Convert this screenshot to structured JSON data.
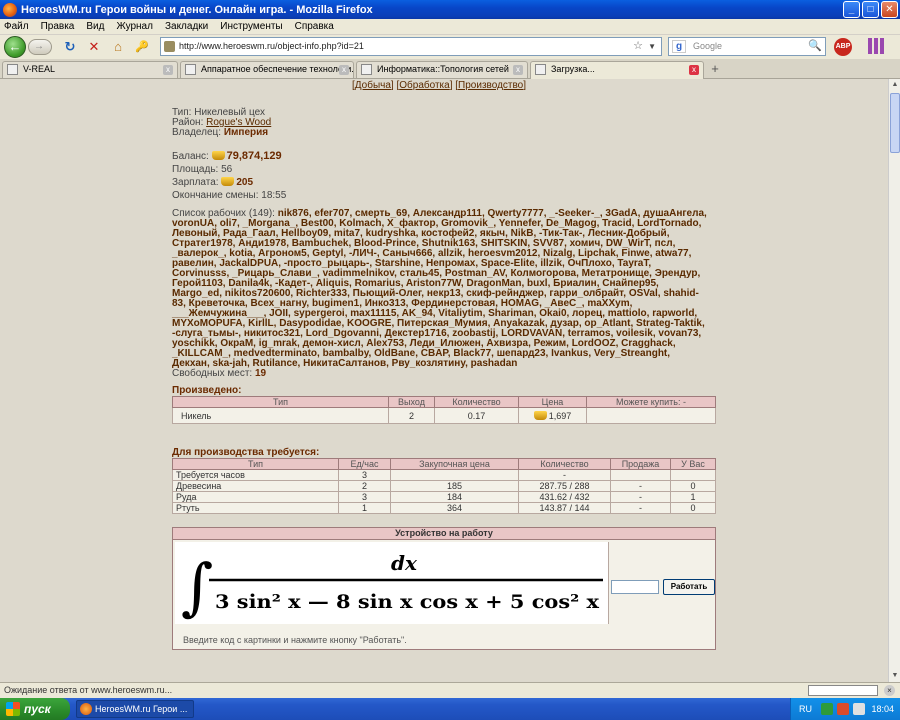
{
  "window": {
    "title": "HeroesWM.ru Герои войны и денег. Онлайн игра. - Mozilla Firefox",
    "min": "_",
    "max": "□",
    "close": "✕"
  },
  "menu": [
    "Файл",
    "Правка",
    "Вид",
    "Журнал",
    "Закладки",
    "Инструменты",
    "Справка"
  ],
  "toolbar": {
    "url": "http://www.heroeswm.ru/object-info.php?id=21",
    "search_placeholder": "Google",
    "abp_label": "ABP",
    "back_glyph": "←",
    "fwd_glyph": "→",
    "reload_glyph": "↻",
    "stop_glyph": "✕",
    "home_glyph": "⌂",
    "key_glyph": "🔑",
    "star_glyph": "☆",
    "drop_glyph": "▼",
    "search_glyph": "🔍",
    "google_glyph": "g"
  },
  "tabs": [
    {
      "label": "V-REAL",
      "close": "x"
    },
    {
      "label": "Аппаратное обеспечение технологи...",
      "close": "x"
    },
    {
      "label": "Информатика::Топология сетей",
      "close": "x"
    },
    {
      "label": "Загрузка...",
      "close": "x"
    }
  ],
  "newtab_label": "+",
  "page": {
    "links": [
      "Добыча",
      "Обработка",
      "Производство"
    ],
    "type_label": "Тип:",
    "type_value": "Никелевый цех",
    "district_label": "Район:",
    "district_value": "Rogue's Wood",
    "owner_label": "Владелец:",
    "owner_value": "Империя",
    "balance_label": "Баланс:",
    "balance_value": "79,874,129",
    "area_label": "Площадь:",
    "area_value": "56",
    "salary_label": "Зарплата:",
    "salary_value": "205",
    "shift_end_label": "Окончание смены:",
    "shift_end_value": "18:55",
    "workers_label": "Список рабочих (149):",
    "workers_text": "nik876, efer707, смерть_69, Александр111, Qwerty7777, _-Seeker-_, 3GadA, душаАнгела, voronUA, oli7, _Morgana_, Best00, Kolmach, X_фактор, Gromovik_, Yennefer, De_Magog, Tracid, LordTornado, Левоный, Рада_Гаал, Hellboy09, mita7, kudryshka, костофей2, якыч, NikB, -Тик-Так-, Лесник-Добрый, Стратег1978, Анди1978, Bambuchek, Blood-Prince, Shutnik163, SHITSKIN, SVV87, хомич, DW_WirT, псл, _валерок_, kotia, Агроном5, Geptyl, -ЛИЧ-, Саныч666, allzik, heroesvm2012, Nizalg, Lipchak, Finwe, atwa77, равелин, JackalDPUA, -просто_рыцарь-, Starshine, Непромах, Space-Elite, illzik, ОчПлохо, TayraT, Corvinusss, _Рицарь_Слави_, vadimmelnikov, сталь45, Postman_AV, Колмогорова, Метатронище, Эрендур, Герой1103, Danila4k, -Кадет-, Aliquis, Romarius, Ariston77W, DragonMan, buxl, Бриалин, Снайпер95, Margo_ed, nikitos720600, Richter333, Пьющий-Олег, некр13, скиф-рейнджер, гарри_олбрайт, OSVal, shahid-83, Креветочка, Всех_нагну, bugimen1, Инко313, Фердинерстовая, HOMAG, _АвеС_, maXXym, ___Жемчужина___, JOII, sypergeroi, max11115, AK_94, Vitaliytim, Shariman, Okai0, лорец, mattiolo, rapworld, MYXoMOPUFA, KirllL, Dasypodidae, KOOGRE, Питерская_Мумия, Anyakazak, дузар, op_Atlant, Strateg-Taktik, -слуга_тьмы-, никитос321, Lord_Dgovanni, Декстер1716, zoobastij, LORDVAVAN, terramos, voilesik, vovan73, yoschikk, ОкраМ, ig_mrak, демон-хисл, Alex753, Леди_Илюжен, Ахвизра, Режим, LordOOZ, Cragghack, _KILLCAM_, medvedterminato, bambalby, OldBane, CBAP, Black77, шепард23, Ivankus, Very_Streanght, Декхан, ska-jah, Rutilance, НикитаСалтанов, Рву_козлятину, pashadan",
    "free_label": "Свободных мест:",
    "free_value": "19",
    "produced_heading": "Произведено:",
    "produced_headers": [
      "Тип",
      "Выход",
      "Количество",
      "Цена",
      "Можете купить: -"
    ],
    "produced_rows": [
      {
        "type": "Никель",
        "output": "2",
        "qty": "0.17",
        "price": "1,697",
        "buy": ""
      }
    ],
    "required_heading": "Для производства требуется:",
    "required_headers": [
      "Тип",
      "Ед/час",
      "Закупочная цена",
      "Количество",
      "Продажа",
      "У Вас"
    ],
    "required_rows": [
      {
        "type": "Требуется часов",
        "rate": "3",
        "price": "",
        "qty": "-",
        "sale": "",
        "have": ""
      },
      {
        "type": "Древесина",
        "rate": "2",
        "price": "185",
        "qty": "287.75 / 288",
        "sale": "-",
        "have": "0"
      },
      {
        "type": "Руда",
        "rate": "3",
        "price": "184",
        "qty": "431.62 / 432",
        "sale": "-",
        "have": "1"
      },
      {
        "type": "Ртуть",
        "rate": "1",
        "price": "364",
        "qty": "143.87 / 144",
        "sale": "-",
        "have": "0"
      }
    ],
    "work_heading": "Устройство на работу",
    "work_button": "Работать",
    "work_instruction": "Введите код с картинки и нажмите кнопку \"Работать\".",
    "captcha": {
      "numerator": "dx",
      "denominator": "3 sin² x — 8 sin x cos x + 5 cos² x",
      "integral": "∫"
    }
  },
  "status": {
    "text": "Ожидание ответа от www.heroeswm.ru..."
  },
  "taskbar": {
    "start_label": "пуск",
    "item_label": "HeroesWM.ru Герои ...",
    "lang": "RU",
    "clock": "18:04"
  },
  "colors": {
    "accent_dark": "#6b2a00",
    "table_header": "#e9c6c6",
    "page_bg": "#ddd9cd"
  }
}
